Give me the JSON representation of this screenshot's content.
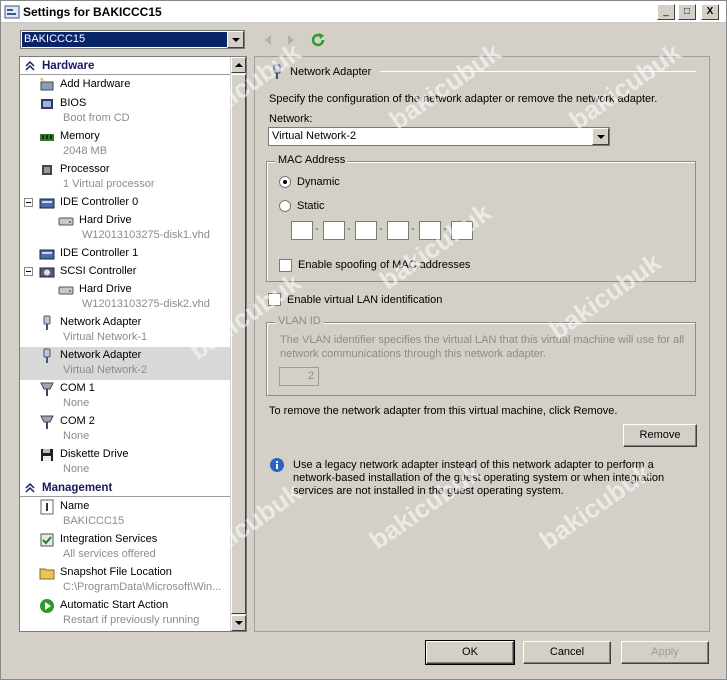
{
  "window": {
    "title": "Settings for BAKICCC15",
    "minimize": "_",
    "maximize": "□",
    "close": "X"
  },
  "vm_select": {
    "value": "BAKICCC15"
  },
  "tree": {
    "hardware_header": "Hardware",
    "management_header": "Management",
    "add_hardware": "Add Hardware",
    "bios": {
      "name": "BIOS",
      "sub": "Boot from CD"
    },
    "memory": {
      "name": "Memory",
      "sub": "2048 MB"
    },
    "processor": {
      "name": "Processor",
      "sub": "1 Virtual processor"
    },
    "ide0": {
      "name": "IDE Controller 0"
    },
    "hd1": {
      "name": "Hard Drive",
      "sub": "W12013103275-disk1.vhd"
    },
    "ide1": {
      "name": "IDE Controller 1"
    },
    "scsi": {
      "name": "SCSI Controller"
    },
    "hd2": {
      "name": "Hard Drive",
      "sub": "W12013103275-disk2.vhd"
    },
    "nic1": {
      "name": "Network Adapter",
      "sub": "Virtual Network-1"
    },
    "nic2": {
      "name": "Network Adapter",
      "sub": "Virtual Network-2"
    },
    "com1": {
      "name": "COM 1",
      "sub": "None"
    },
    "com2": {
      "name": "COM 2",
      "sub": "None"
    },
    "diskette": {
      "name": "Diskette Drive",
      "sub": "None"
    },
    "mgmt_name": {
      "name": "Name",
      "sub": "BAKICCC15"
    },
    "integration": {
      "name": "Integration Services",
      "sub": "All services offered"
    },
    "snapshot": {
      "name": "Snapshot File Location",
      "sub": "C:\\ProgramData\\Microsoft\\Win..."
    },
    "autostart": {
      "name": "Automatic Start Action",
      "sub": "Restart if previously running"
    }
  },
  "panel": {
    "title": "Network Adapter",
    "description": "Specify the configuration of the network adapter or remove the network adapter.",
    "network_label": "Network:",
    "network_value": "Virtual Network-2",
    "mac_group": "MAC Address",
    "dynamic": "Dynamic",
    "static": "Static",
    "mac_dash": "-",
    "spoofing": "Enable spoofing of MAC addresses",
    "vlan_enable": "Enable virtual LAN identification",
    "vlan_group": "VLAN ID",
    "vlan_desc_1": "The VLAN identifier specifies the virtual LAN that this virtual machine will use for all",
    "vlan_desc_2": "network communications through this network adapter.",
    "vlan_value": "2",
    "remove_text": "To remove the network adapter from this virtual machine, click Remove.",
    "remove_button": "Remove",
    "info_1": "Use a legacy network adapter instead of this network adapter to perform a",
    "info_2": "network-based installation of the guest operating system or when integration",
    "info_3": "services are not installed in the guest operating system."
  },
  "footer": {
    "ok": "OK",
    "cancel": "Cancel",
    "apply": "Apply"
  },
  "watermark": "bakicubuk"
}
